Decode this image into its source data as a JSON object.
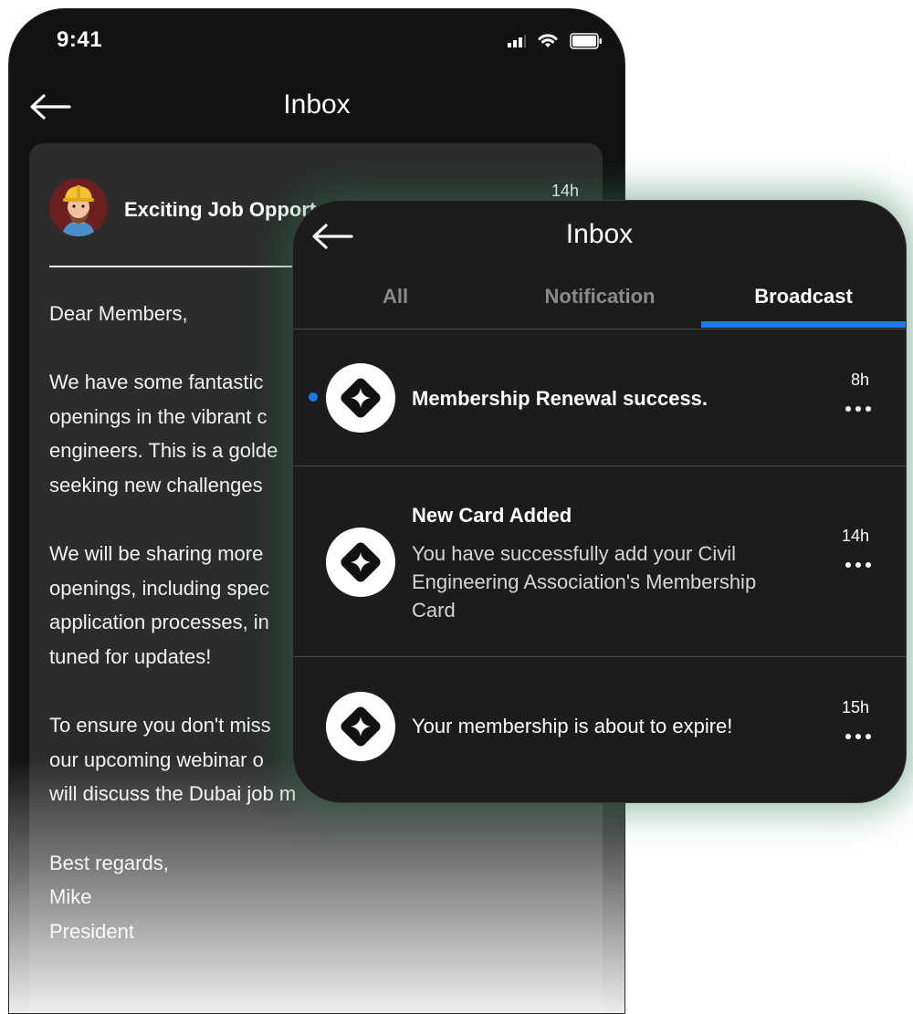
{
  "status_bar": {
    "time": "9:41"
  },
  "back_screen": {
    "title": "Inbox",
    "message": {
      "subject": "Exciting Job Opport",
      "time": "14h",
      "greeting": "Dear Members,",
      "paragraph_1": [
        "We have some fantastic",
        "openings in the vibrant c",
        "engineers. This is a golde",
        "seeking new challenges"
      ],
      "paragraph_2": [
        "We will be sharing more",
        "openings, including spec",
        "application processes, in",
        "tuned for updates!"
      ],
      "paragraph_3": [
        "To ensure you don't miss",
        "our upcoming webinar o",
        "will discuss the Dubai job m"
      ],
      "closing": "Best regards,",
      "sender_name": "Mike",
      "sender_title": "President"
    }
  },
  "front_screen": {
    "title": "Inbox",
    "tabs": [
      {
        "label": "All"
      },
      {
        "label": "Notification"
      },
      {
        "label": "Broadcast",
        "active": true
      }
    ],
    "accent_color": "#1b7ae8",
    "notifications": [
      {
        "title": "Membership Renewal success.",
        "time": "8h",
        "unread": true,
        "icon": "diamond-sparkle-icon"
      },
      {
        "title": "New Card Added",
        "description": "You have successfully add your Civil Engineering Association's Membership Card",
        "time": "14h",
        "unread": false,
        "icon": "diamond-sparkle-icon"
      },
      {
        "title": "Your membership is about to expire!",
        "time": "15h",
        "unread": false,
        "icon": "diamond-sparkle-icon"
      }
    ]
  }
}
